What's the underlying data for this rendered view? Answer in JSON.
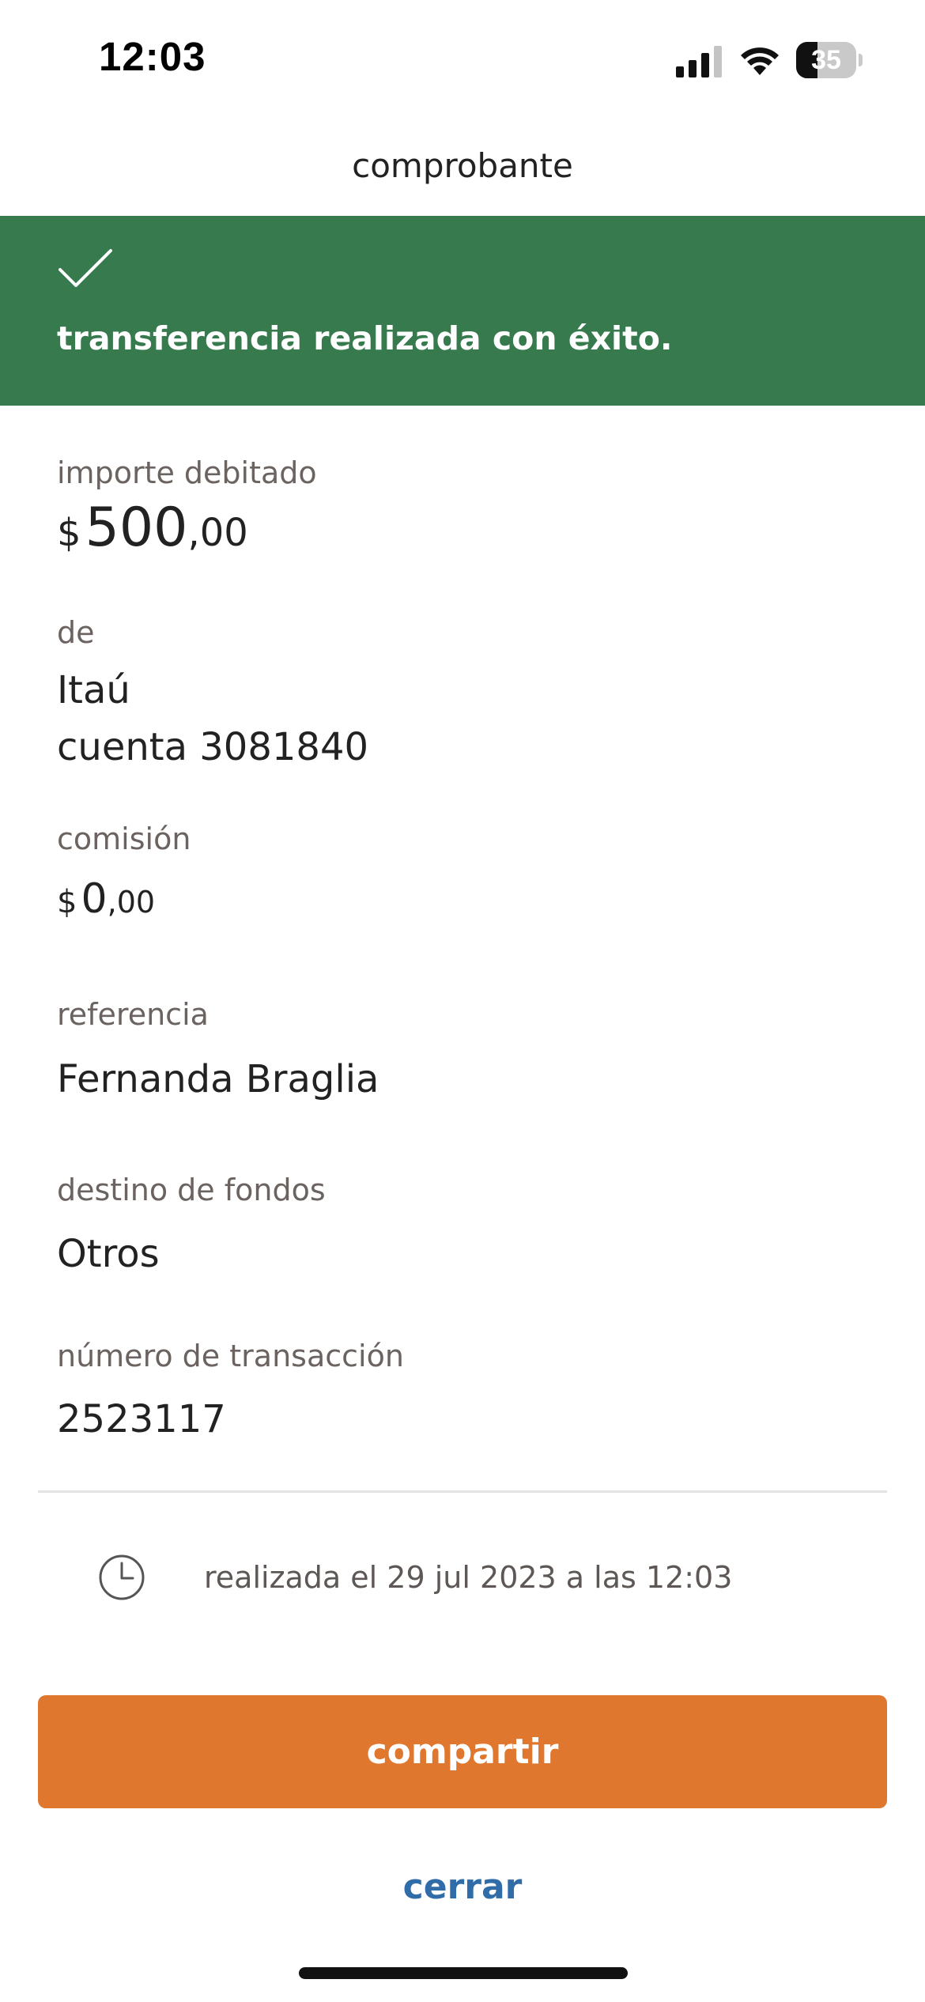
{
  "status_bar": {
    "time": "12:03",
    "battery_level": "35",
    "battery_fraction": 0.35
  },
  "header": {
    "title": "comprobante"
  },
  "banner": {
    "icon": "check-icon",
    "message": "transferencia realizada con éxito.",
    "color": "#367a4e"
  },
  "fields": {
    "amount": {
      "label": "importe debitado",
      "currency": "$",
      "integer": "500",
      "decimals": ",00"
    },
    "from": {
      "label": "de",
      "bank": "Itaú",
      "account": "cuenta 3081840"
    },
    "fee": {
      "label": "comisión",
      "currency": "$",
      "integer": "0",
      "decimals": ",00"
    },
    "reference": {
      "label": "referencia",
      "value": "Fernanda Braglia"
    },
    "destination": {
      "label": "destino de fondos",
      "value": "Otros"
    },
    "transaction": {
      "label": "número de transacción",
      "value": "2523117"
    }
  },
  "timestamp": {
    "icon": "clock-icon",
    "text": "realizada el 29 jul 2023 a las 12:03"
  },
  "actions": {
    "share_label": "compartir",
    "share_color": "#df772e",
    "close_label": "cerrar",
    "close_color": "#2f6ca8"
  }
}
